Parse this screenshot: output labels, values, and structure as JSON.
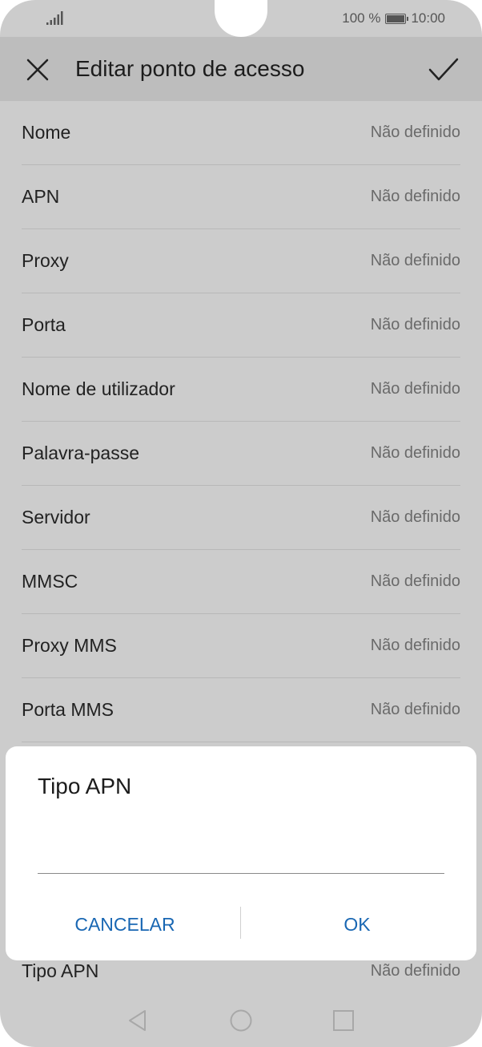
{
  "status_bar": {
    "battery": "100 %",
    "time": "10:00"
  },
  "header": {
    "title": "Editar ponto de acesso"
  },
  "settings": [
    {
      "label": "Nome",
      "value": "Não definido"
    },
    {
      "label": "APN",
      "value": "Não definido"
    },
    {
      "label": "Proxy",
      "value": "Não definido"
    },
    {
      "label": "Porta",
      "value": "Não definido"
    },
    {
      "label": "Nome de utilizador",
      "value": "Não definido"
    },
    {
      "label": "Palavra-passe",
      "value": "Não definido"
    },
    {
      "label": "Servidor",
      "value": "Não definido"
    },
    {
      "label": "MMSC",
      "value": "Não definido"
    },
    {
      "label": "Proxy MMS",
      "value": "Não definido"
    },
    {
      "label": "Porta MMS",
      "value": "Não definido"
    }
  ],
  "bottom_setting": {
    "label": "Tipo APN",
    "value": "Não definido"
  },
  "dialog": {
    "title": "Tipo APN",
    "input_value": "",
    "cancel_label": "CANCELAR",
    "ok_label": "OK"
  },
  "colors": {
    "accent": "#1967b3",
    "overlay": "#cccccc"
  }
}
